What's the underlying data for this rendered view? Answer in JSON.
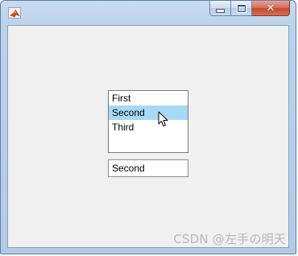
{
  "window": {
    "controls": {
      "minimize_icon": "minimize-icon",
      "maximize_icon": "maximize-icon",
      "close_icon": "close-icon",
      "close_glyph": "✕"
    },
    "app_icon": "matlab-logo-icon"
  },
  "listbox": {
    "items": [
      {
        "label": "First"
      },
      {
        "label": "Second"
      },
      {
        "label": "Third"
      }
    ],
    "selected_index": 1,
    "selection_color": "#a9d8f7"
  },
  "textfield": {
    "value": "Second"
  },
  "watermark": {
    "text": "CSDN @左手の明天"
  },
  "colors": {
    "client_background": "#f0f0f0",
    "close_button": "#c24a33"
  }
}
